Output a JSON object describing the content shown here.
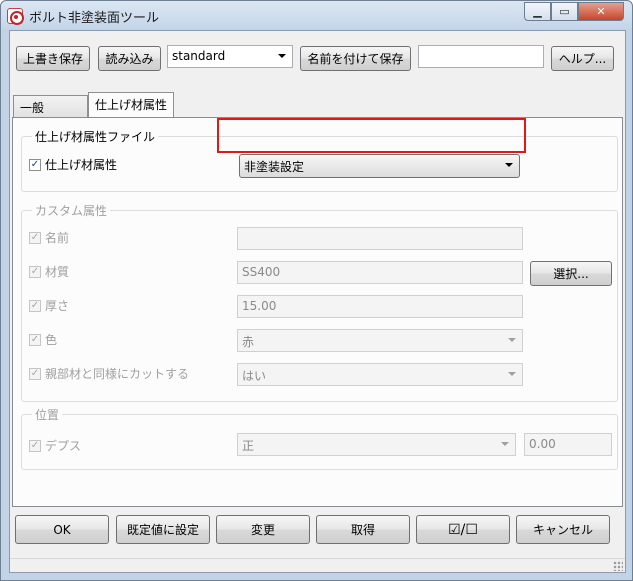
{
  "window": {
    "title": "ボルト非塗装面ツール"
  },
  "toolbar": {
    "overwrite_save": "上書き保存",
    "load": "読み込み",
    "preset_value": "standard",
    "save_as": "名前を付けて保存",
    "save_as_name": "",
    "help": "ヘルプ..."
  },
  "tabs": [
    "一般",
    "仕上げ材属性"
  ],
  "finish_file_group": {
    "label": "仕上げ材属性ファイル",
    "checkbox_label": "仕上げ材属性",
    "selected": "非塗装設定"
  },
  "custom_group": {
    "label": "カスタム属性",
    "name_label": "名前",
    "name_value": "",
    "material_label": "材質",
    "material_value": "SS400",
    "select_button": "選択...",
    "thickness_label": "厚さ",
    "thickness_value": "15.00",
    "color_label": "色",
    "color_value": "赤",
    "cut_label": "親部材と同様にカットする",
    "cut_value": "はい"
  },
  "position_group": {
    "label": "位置",
    "depth_label": "デプス",
    "depth_value": "正",
    "depth_offset": "0.00"
  },
  "footer": {
    "ok": "OK",
    "set_default": "既定値に設定",
    "change": "変更",
    "get": "取得",
    "toggle": "☑/☐",
    "cancel": "キャンセル"
  },
  "check_mark": "✓"
}
